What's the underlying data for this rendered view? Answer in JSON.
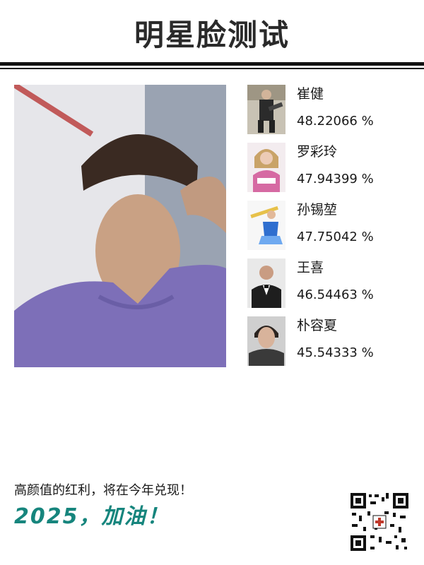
{
  "page": {
    "title": "明星脸测试",
    "slogan": "高颜值的红利，将在今年兑现！",
    "cheer": "2025，加油！"
  },
  "matches": [
    {
      "name": "崔健",
      "score": "48.22066 %",
      "thumb_icon": "celebrity-photo-icon",
      "accent": "#2b2b2b"
    },
    {
      "name": "罗彩玲",
      "score": "47.94399 %",
      "thumb_icon": "celebrity-photo-icon",
      "accent": "#d66aa3"
    },
    {
      "name": "孙锡堃",
      "score": "47.75042 %",
      "thumb_icon": "celebrity-photo-icon",
      "accent": "#2f6fcf"
    },
    {
      "name": "王喜",
      "score": "46.54463 %",
      "thumb_icon": "celebrity-photo-icon",
      "accent": "#1e1e1e"
    },
    {
      "name": "朴容夏",
      "score": "45.54333 %",
      "thumb_icon": "celebrity-photo-icon",
      "accent": "#3a3a3a"
    }
  ],
  "colors": {
    "cheer": "#16857d",
    "rule": "#111111"
  }
}
